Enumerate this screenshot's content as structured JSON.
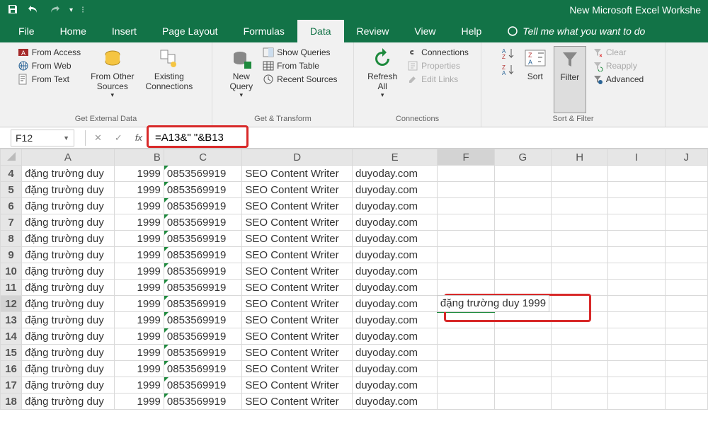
{
  "window": {
    "title": "New Microsoft Excel Workshe"
  },
  "tabs": {
    "file": "File",
    "home": "Home",
    "insert": "Insert",
    "page_layout": "Page Layout",
    "formulas": "Formulas",
    "data": "Data",
    "review": "Review",
    "view": "View",
    "help": "Help",
    "tell_me": "Tell me what you want to do"
  },
  "ribbon": {
    "get_external_data": {
      "from_access": "From Access",
      "from_web": "From Web",
      "from_text": "From Text",
      "from_other_sources": "From Other\nSources",
      "existing_connections": "Existing\nConnections",
      "label": "Get External Data"
    },
    "get_transform": {
      "new_query": "New\nQuery",
      "show_queries": "Show Queries",
      "from_table": "From Table",
      "recent_sources": "Recent Sources",
      "label": "Get & Transform"
    },
    "connections": {
      "refresh_all": "Refresh\nAll",
      "connections": "Connections",
      "properties": "Properties",
      "edit_links": "Edit Links",
      "label": "Connections"
    },
    "sort_filter": {
      "sort": "Sort",
      "filter": "Filter",
      "clear": "Clear",
      "reapply": "Reapply",
      "advanced": "Advanced",
      "label": "Sort & Filter"
    }
  },
  "name_box": "F12",
  "formula": "=A13&\" \"&B13",
  "columns": [
    "A",
    "B",
    "C",
    "D",
    "E",
    "F",
    "G",
    "H",
    "I",
    "J"
  ],
  "selected_col": "F",
  "selected_row": 12,
  "current_cell_value": "đặng trường duy 1999",
  "rows": [
    {
      "n": 4,
      "a": "đặng trường duy",
      "b": "1999",
      "c": "0853569919",
      "d": "SEO Content Writer",
      "e": "duyoday.com"
    },
    {
      "n": 5,
      "a": "đặng trường duy",
      "b": "1999",
      "c": "0853569919",
      "d": "SEO Content Writer",
      "e": "duyoday.com"
    },
    {
      "n": 6,
      "a": "đặng trường duy",
      "b": "1999",
      "c": "0853569919",
      "d": "SEO Content Writer",
      "e": "duyoday.com"
    },
    {
      "n": 7,
      "a": "đặng trường duy",
      "b": "1999",
      "c": "0853569919",
      "d": "SEO Content Writer",
      "e": "duyoday.com"
    },
    {
      "n": 8,
      "a": "đặng trường duy",
      "b": "1999",
      "c": "0853569919",
      "d": "SEO Content Writer",
      "e": "duyoday.com"
    },
    {
      "n": 9,
      "a": "đặng trường duy",
      "b": "1999",
      "c": "0853569919",
      "d": "SEO Content Writer",
      "e": "duyoday.com"
    },
    {
      "n": 10,
      "a": "đặng trường duy",
      "b": "1999",
      "c": "0853569919",
      "d": "SEO Content Writer",
      "e": "duyoday.com"
    },
    {
      "n": 11,
      "a": "đặng trường duy",
      "b": "1999",
      "c": "0853569919",
      "d": "SEO Content Writer",
      "e": "duyoday.com"
    },
    {
      "n": 12,
      "a": "đặng trường duy",
      "b": "1999",
      "c": "0853569919",
      "d": "SEO Content Writer",
      "e": "duyoday.com"
    },
    {
      "n": 13,
      "a": "đặng trường duy",
      "b": "1999",
      "c": "0853569919",
      "d": "SEO Content Writer",
      "e": "duyoday.com"
    },
    {
      "n": 14,
      "a": "đặng trường duy",
      "b": "1999",
      "c": "0853569919",
      "d": "SEO Content Writer",
      "e": "duyoday.com"
    },
    {
      "n": 15,
      "a": "đặng trường duy",
      "b": "1999",
      "c": "0853569919",
      "d": "SEO Content Writer",
      "e": "duyoday.com"
    },
    {
      "n": 16,
      "a": "đặng trường duy",
      "b": "1999",
      "c": "0853569919",
      "d": "SEO Content Writer",
      "e": "duyoday.com"
    },
    {
      "n": 17,
      "a": "đặng trường duy",
      "b": "1999",
      "c": "0853569919",
      "d": "SEO Content Writer",
      "e": "duyoday.com"
    },
    {
      "n": 18,
      "a": "đặng trường duy",
      "b": "1999",
      "c": "0853569919",
      "d": "SEO Content Writer",
      "e": "duyoday.com"
    }
  ]
}
